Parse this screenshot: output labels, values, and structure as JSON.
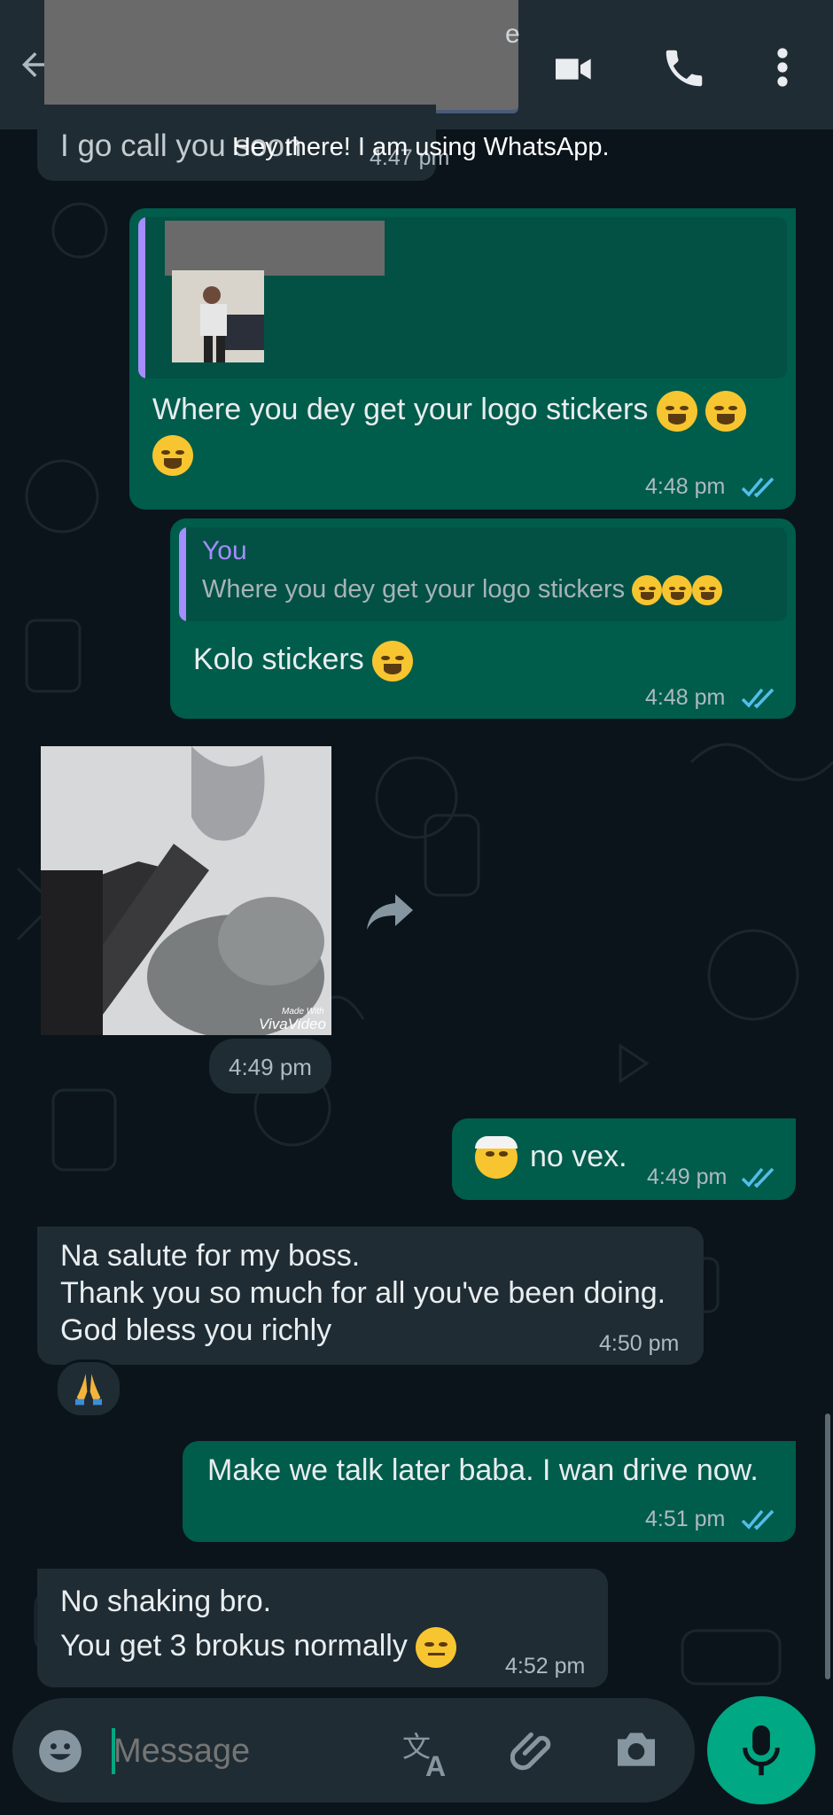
{
  "header": {
    "title_partial": "e",
    "status": "Hey there! I am using WhatsApp."
  },
  "messages": {
    "m0": {
      "text": "I go call you soon",
      "time": "4:47 pm"
    },
    "m1": {
      "text": "Where you dey get your logo stickers",
      "time": "4:48 pm"
    },
    "m2": {
      "quote_author": "You",
      "quote_text": "Where you dey get your logo stickers",
      "text": "Kolo stickers",
      "time": "4:48 pm"
    },
    "m3": {
      "watermark_small": "Made With",
      "watermark": "VivaVideo",
      "time": "4:49 pm"
    },
    "m4": {
      "text": "no vex.",
      "time": "4:49 pm"
    },
    "m5": {
      "line1": "Na salute for my boss.",
      "line2": "Thank you so much for all you've been doing.",
      "line3": "God bless you richly",
      "time": "4:50 pm",
      "reaction": "🙏"
    },
    "m6": {
      "text": "Make we talk later baba. I wan drive now.",
      "time": "4:51 pm"
    },
    "m7": {
      "line1": "No shaking bro.",
      "line2": "You get 3 brokus normally",
      "time": "4:52 pm"
    }
  },
  "composer": {
    "placeholder": "Message"
  },
  "colors": {
    "background": "#0b141a",
    "incoming": "#1f2c34",
    "outgoing": "#005c4b",
    "accent": "#00a884",
    "read_ticks": "#53bdeb"
  },
  "icons": [
    "back-arrow-icon",
    "video-call-icon",
    "voice-call-icon",
    "more-options-icon",
    "forward-icon",
    "read-ticks-icon",
    "emoji-icon",
    "translate-icon",
    "attach-icon",
    "camera-icon",
    "mic-icon"
  ]
}
